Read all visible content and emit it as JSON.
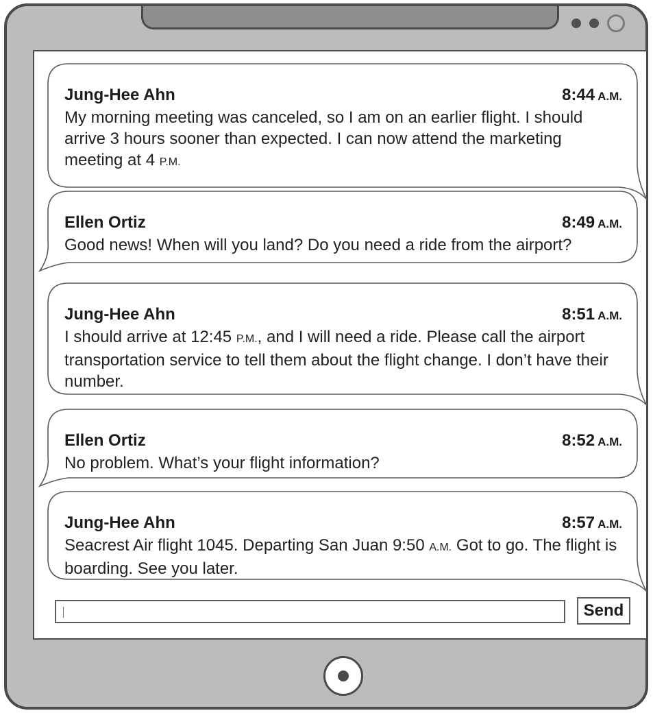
{
  "messages": [
    {
      "sender": "Jung-Hee Ahn",
      "time": "8:44",
      "ampm": "A.M.",
      "text_parts": [
        "My morning meeting was canceled, so I am on an earlier flight. I should arrive 3 hours sooner than expected. I can now attend the marketing meeting at 4 ",
        "P.M."
      ]
    },
    {
      "sender": "Ellen Ortiz",
      "time": "8:49",
      "ampm": "A.M.",
      "text_parts": [
        "Good news! When will you land? Do you need a ride from the airport?"
      ]
    },
    {
      "sender": "Jung-Hee Ahn",
      "time": "8:51",
      "ampm": "A.M.",
      "text_parts": [
        "I should arrive at 12:45 ",
        "P.M.",
        ", and I will need a ride. Please call the airport transportation service to tell them about the flight change. I don’t have their number."
      ]
    },
    {
      "sender": "Ellen Ortiz",
      "time": "8:52",
      "ampm": "A.M.",
      "text_parts": [
        "No problem. What’s your flight information?"
      ]
    },
    {
      "sender": "Jung-Hee Ahn",
      "time": "8:57",
      "ampm": "A.M.",
      "text_parts": [
        "Seacrest Air flight 1045. Departing San Juan 9:50 ",
        "A.M.",
        " Got to go. The flight is boarding. See you later."
      ]
    }
  ],
  "compose": {
    "value": "",
    "send_label": "Send"
  }
}
